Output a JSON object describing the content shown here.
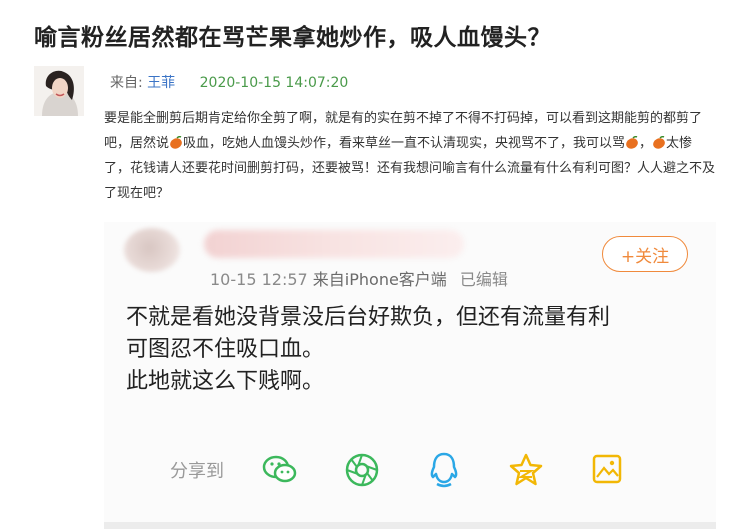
{
  "title": "喻言粉丝居然都在骂芒果拿她炒作，吸人血馒头？",
  "post": {
    "from_label": "来自:",
    "author": "王菲",
    "timestamp": "2020-10-15 14:07:20",
    "text_parts": [
      "要是能全删剪后期肯定给你全剪了啊，就是有的实在剪不掉了不得不打码掉，可以看到这期能剪的都剪了吧，居然说",
      "吸血，吃她人血馒头炒作，看来草丝一直不认清现实，央视骂不了，我可以骂",
      "，",
      "太惨了，花钱请人还要花时间删剪打码，还要被骂！还有我想问喻言有什么流量有什么有利可图？人人避之不及了现在吧？"
    ]
  },
  "screenshot": {
    "follow_label": "+关注",
    "time": "10-15 12:57",
    "source_prefix": "来自",
    "source": "iPhone客户端",
    "edited": "已编辑",
    "lines": [
      "不就是看她没背景没后台好欺负，但还有流量有利",
      "可图忍不住吸口血。",
      "此地就这么下贱啊。"
    ],
    "share_label": "分享到",
    "share_icons": [
      "wechat-icon",
      "moments-icon",
      "qq-icon",
      "qzone-icon",
      "weibo-album-icon"
    ]
  },
  "colors": {
    "author": "#3b74c6",
    "timestamp": "#4a9a4a",
    "follow": "#f08a3c",
    "share_green": "#3cb85c",
    "share_blue": "#2aa7e6",
    "share_yellow": "#f2b705",
    "mango": "#e8701f"
  }
}
